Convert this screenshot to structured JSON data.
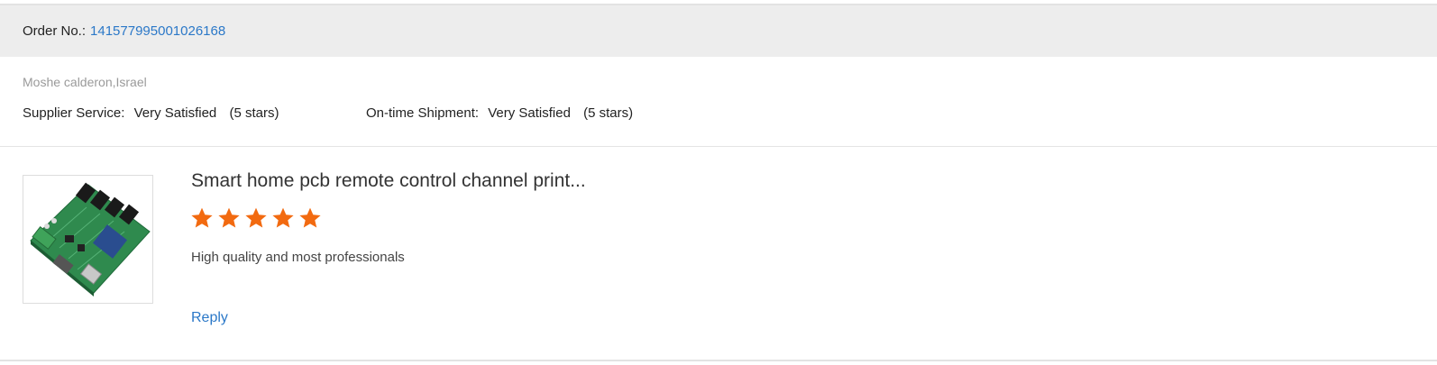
{
  "order": {
    "label": "Order No.:",
    "number": "141577995001026168"
  },
  "buyer": {
    "name": "Moshe calderon,Israel"
  },
  "ratings": {
    "supplier_service": {
      "label": "Supplier Service:",
      "value": "Very Satisfied",
      "stars_text": "(5 stars)"
    },
    "ontime_shipment": {
      "label": "On-time Shipment:",
      "value": "Very Satisfied",
      "stars_text": "(5 stars)"
    }
  },
  "product": {
    "title": "Smart home pcb remote control channel print...",
    "rating": 5,
    "rating_max": 5,
    "review": "High quality and most professionals",
    "reply_label": "Reply",
    "image_icon": "pcb-board-image"
  },
  "colors": {
    "link": "#2b78c8",
    "star": "#f26a10",
    "header_bg": "#ededed"
  }
}
